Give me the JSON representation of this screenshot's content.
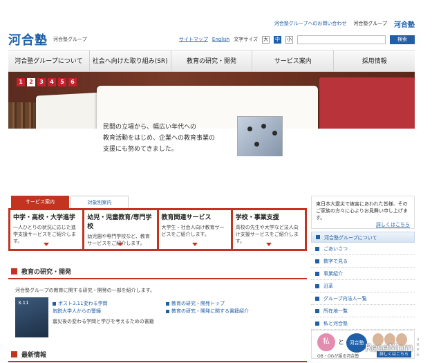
{
  "topbar": {
    "contact": "河合塾グループへのお問い合わせ",
    "group": "河合塾グループ",
    "logo_small": "河合塾"
  },
  "header": {
    "logo": "河合塾",
    "logo_sub": "河合塾グループ",
    "sitemap": "サイトマップ",
    "english": "English",
    "font_size_label": "文字サイズ",
    "font_sizes": [
      "大",
      "中",
      "小"
    ],
    "search_button": "検索",
    "search_placeholder": ""
  },
  "nav": {
    "items": [
      "河合塾グループについて",
      "社会へ向けた取り組み(SR)",
      "教育の研究・開発",
      "サービス案内",
      "採用情報"
    ]
  },
  "hero": {
    "slides": [
      "1",
      "2",
      "3",
      "4",
      "5",
      "6"
    ],
    "active_slide": "2",
    "text": "民間の立場から、幅広い年代への\n教育活動をはじめ、企業への教育事業の\n支援にも努めてきました。"
  },
  "services": {
    "tabs": [
      "サービス案内",
      "対象別案内"
    ],
    "cards": [
      {
        "title": "中学・高校・大学進学",
        "desc": "一人ひとりの状況に応じた進学支援サービスをご紹介します。"
      },
      {
        "title": "幼児・児童教育/専門学校",
        "desc": "幼児園や専門学校など、教育サービスをご紹介します。"
      },
      {
        "title": "教育関連サービス",
        "desc": "大学生・社会人向け教育サービスをご紹介します。"
      },
      {
        "title": "学校・事業支援",
        "desc": "高校の先生や大学など法人向け支援サービスをご紹介します。"
      }
    ]
  },
  "research": {
    "title": "教育の研究・開発",
    "intro": "河合塾グループの教育に関する研究・開発の一部を紹介します。",
    "thumb_text": "3.11",
    "links_left": [
      "ポスト3.11変わる学問",
      "気鋭大学人からの警鐘"
    ],
    "plain_left": "震災後の変わる学問と学びを考えるための書籍",
    "links_right": [
      "教育の研究・開発トップ",
      "教育の研究・開発に関する書籍紹介"
    ]
  },
  "news": {
    "title": "最新情報"
  },
  "right": {
    "notice": "東日本大震災で被害にあわれた皆様、そのご家族の方々に心よりお見舞い申し上げます。",
    "notice_more": "詳しくはこちら",
    "group_title": "河合塾グループについて",
    "group_items": [
      "ごあいさつ",
      "数字で見る",
      "事業紹介",
      "沿革",
      "グループ内法人一覧",
      "所在地一覧",
      "私と河合塾"
    ]
  },
  "ob_banner": {
    "badge1": "私",
    "to": "と",
    "badge2": "河合塾",
    "caption": "OB・OGが語る河合塾",
    "button": "詳しくはこちら"
  },
  "watermark": {
    "text": "ReseMom",
    "sub": "リセマム"
  }
}
